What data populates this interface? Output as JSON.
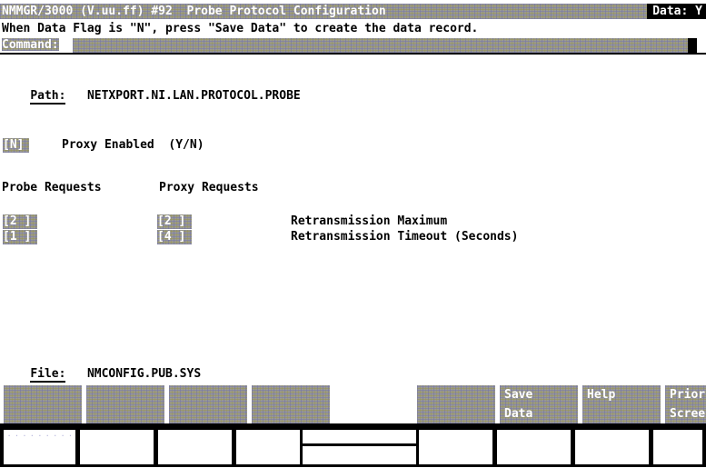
{
  "window": {
    "title": "NMMGR/3000 (V.uu.ff) #92  Probe Protocol Configuration",
    "data_flag_label": "Data: Y",
    "message": "When Data Flag is \"N\", press \"Save Data\" to create the data record.",
    "command_label": "Command:",
    "command_value": ""
  },
  "colors": {
    "background": "#ffffff",
    "foreground": "#000000",
    "inverse_text": "#ffffff",
    "dither_base": "#9a9a94",
    "dither_violet": "#7878aa",
    "dither_olive": "#96914b"
  },
  "path": {
    "label": "Path:",
    "value": "NETXPORT.NI.LAN.PROTOCOL.PROBE"
  },
  "file": {
    "label": "File:",
    "value": "NMCONFIG.PUB.SYS"
  },
  "form": {
    "proxy_enabled": {
      "field_open": "[",
      "value": "N",
      "field_close": "]",
      "label": "Proxy Enabled  (Y/N)"
    },
    "column_headers": [
      "Probe Requests",
      "Proxy Requests"
    ],
    "rows": [
      {
        "probe_value": "2 ",
        "proxy_value": "2 ",
        "label": "Retransmission Maximum"
      },
      {
        "probe_value": "1 ",
        "proxy_value": "4 ",
        "label": "Retransmission Timeout (Seconds)"
      }
    ],
    "field_open": "[",
    "field_close": "]"
  },
  "function_keys": [
    {
      "key": "f1",
      "line1": "",
      "line2": "",
      "blank": false
    },
    {
      "key": "f2",
      "line1": "",
      "line2": "",
      "blank": false
    },
    {
      "key": "f3",
      "line1": "",
      "line2": "",
      "blank": false
    },
    {
      "key": "f4",
      "line1": "",
      "line2": "",
      "blank": false
    },
    {
      "key": "f5",
      "line1": "",
      "line2": "",
      "blank": true
    },
    {
      "key": "f6",
      "line1": "",
      "line2": "",
      "blank": false
    },
    {
      "key": "f7",
      "line1": "Save",
      "line2": "Data",
      "blank": false
    },
    {
      "key": "f8",
      "line1": "Help",
      "line2": "",
      "blank": false
    },
    {
      "key": "f9",
      "line1": "Prior",
      "line2": "Screen",
      "blank": false
    }
  ]
}
